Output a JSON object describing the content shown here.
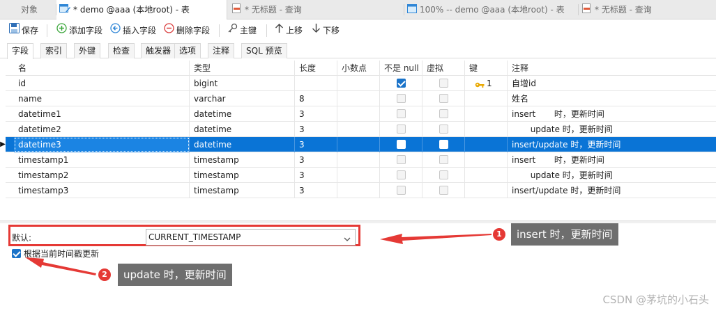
{
  "window_tabs": [
    {
      "label": "对象"
    },
    {
      "label": "* demo @aaa (本地root) - 表"
    },
    {
      "label": "* 无标题 - 查询"
    },
    {
      "label": "100% -- demo @aaa (本地root) - 表"
    },
    {
      "label": "* 无标题 - 查询"
    }
  ],
  "toolbar": {
    "save": "保存",
    "add_field": "添加字段",
    "insert_field": "插入字段",
    "delete_field": "删除字段",
    "primary_key": "主键",
    "move_up": "上移",
    "move_down": "下移"
  },
  "subtabs": [
    "字段",
    "索引",
    "外键",
    "检查",
    "触发器",
    "选项",
    "注释",
    "SQL 预览"
  ],
  "grid": {
    "headers": [
      "名",
      "类型",
      "长度",
      "小数点",
      "不是 null",
      "虚拟",
      "键",
      "注释"
    ],
    "rows": [
      {
        "name": "id",
        "type": "bigint",
        "length": "",
        "decimals": "",
        "not_null": true,
        "virtual": false,
        "key": "1",
        "comment": "自增id"
      },
      {
        "name": "name",
        "type": "varchar",
        "length": "8",
        "decimals": "",
        "not_null": false,
        "virtual": false,
        "key": "",
        "comment": "姓名"
      },
      {
        "name": "datetime1",
        "type": "datetime",
        "length": "3",
        "decimals": "",
        "not_null": false,
        "virtual": false,
        "key": "",
        "comment": "insert       时，更新时间"
      },
      {
        "name": "datetime2",
        "type": "datetime",
        "length": "3",
        "decimals": "",
        "not_null": false,
        "virtual": false,
        "key": "",
        "comment": "       update 时，更新时间"
      },
      {
        "name": "datetime3",
        "type": "datetime",
        "length": "3",
        "decimals": "",
        "not_null": false,
        "virtual": false,
        "key": "",
        "comment": "insert/update 时，更新时间"
      },
      {
        "name": "timestamp1",
        "type": "timestamp",
        "length": "3",
        "decimals": "",
        "not_null": false,
        "virtual": false,
        "key": "",
        "comment": "insert       时，更新时间"
      },
      {
        "name": "timestamp2",
        "type": "timestamp",
        "length": "3",
        "decimals": "",
        "not_null": false,
        "virtual": false,
        "key": "",
        "comment": "       update 时，更新时间"
      },
      {
        "name": "timestamp3",
        "type": "timestamp",
        "length": "3",
        "decimals": "",
        "not_null": false,
        "virtual": false,
        "key": "",
        "comment": "insert/update 时，更新时间"
      }
    ],
    "selected_index": 4
  },
  "props": {
    "default_label": "默认:",
    "default_value": "CURRENT_TIMESTAMP",
    "on_update_label": "根据当前时间戳更新",
    "on_update_checked": true
  },
  "annotations": [
    {
      "number": "1",
      "text": "insert 时，更新时间"
    },
    {
      "number": "2",
      "text": "update 时，更新时间"
    }
  ],
  "watermark": "CSDN @茅坑的小石头",
  "colors": {
    "selection": "#0a74d6",
    "annotation_red": "#e53935",
    "callout_bg": "#6e6e6e",
    "checkbox_on": "#1a73c9"
  }
}
